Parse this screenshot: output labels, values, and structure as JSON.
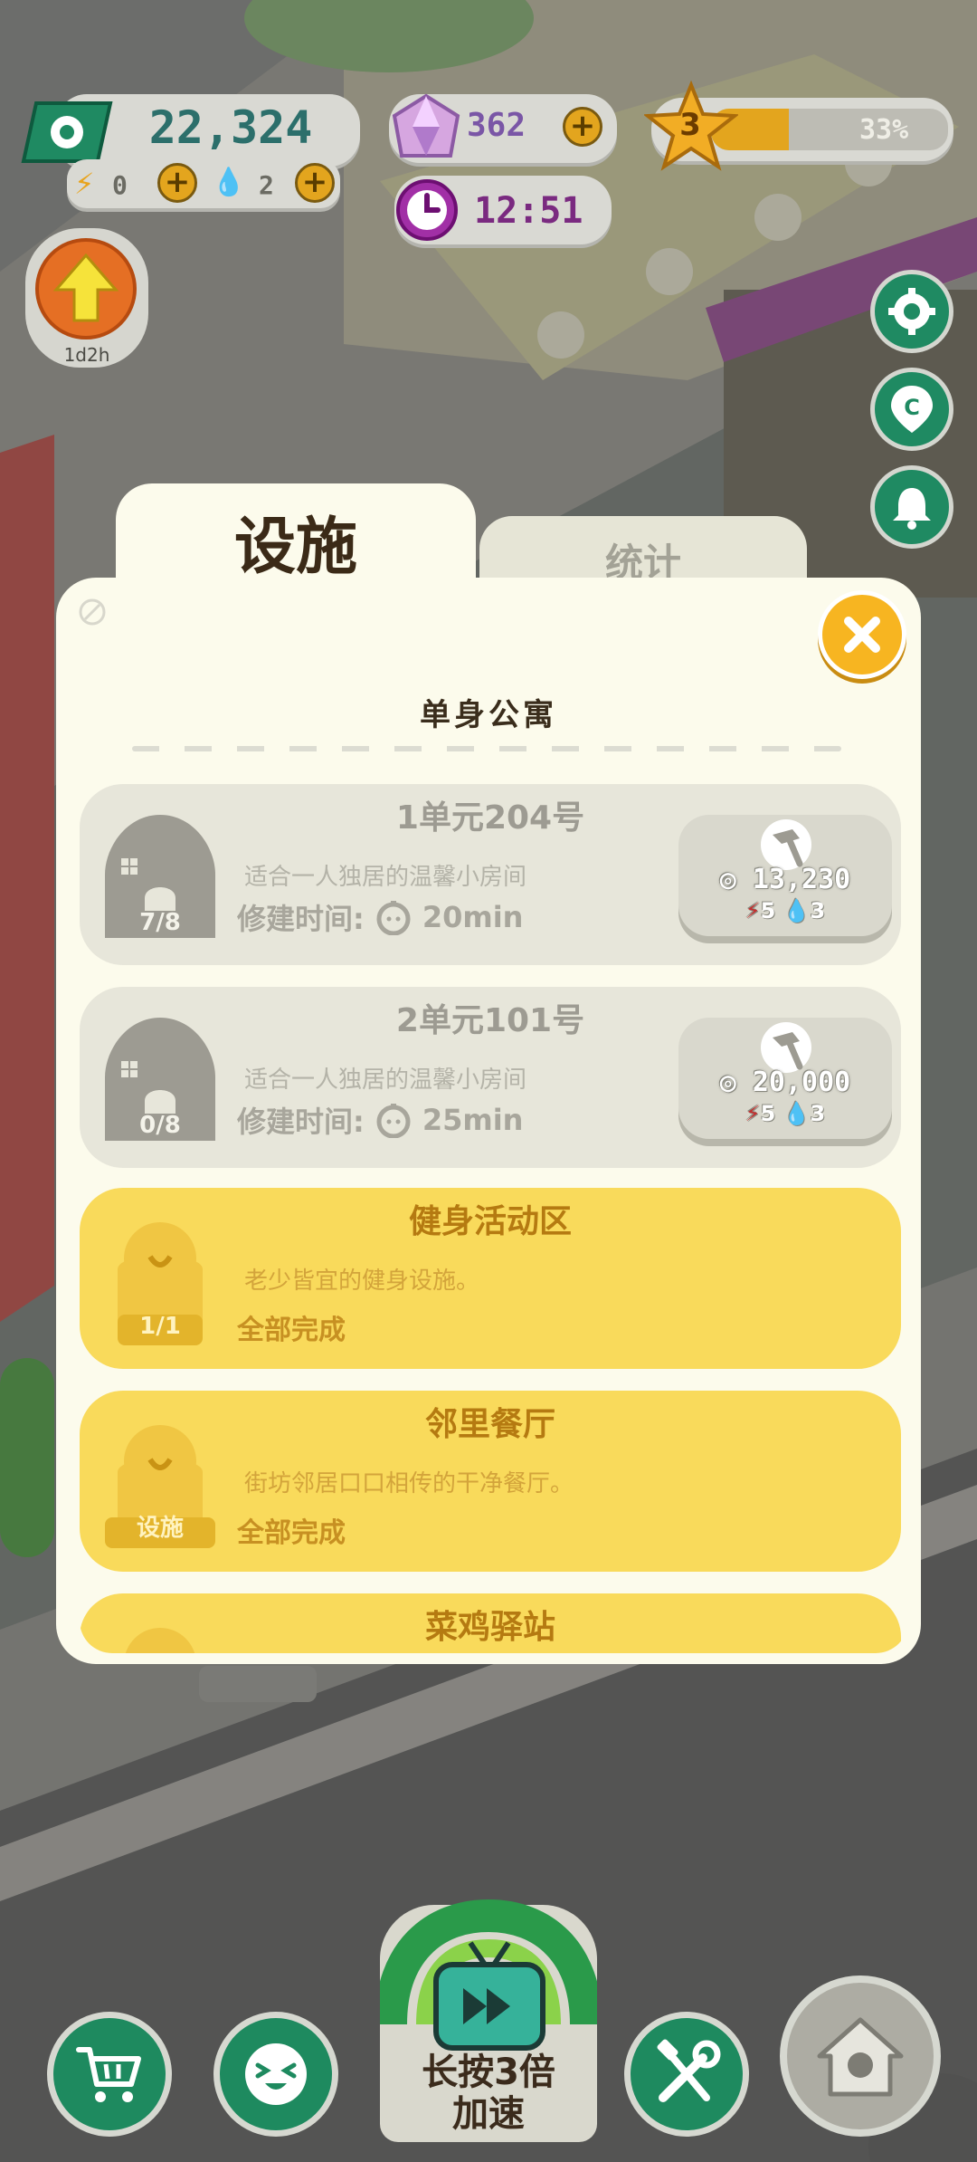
{
  "hud": {
    "cash": "22,324",
    "energy": "0",
    "water": "2",
    "gems": "362",
    "level": "3",
    "level_progress_text": "33%",
    "level_progress": 0.33,
    "clock": "12:51",
    "upgrade_timer": "1d2h"
  },
  "dialog": {
    "tabs": [
      "设施",
      "统计"
    ],
    "section_title": "单身公寓",
    "cards": [
      {
        "title": "1单元204号",
        "desc": "适合一人独居的温馨小房间",
        "build_label": "修建时间:",
        "build_time": "20min",
        "count": "7/8",
        "cost": "13,230",
        "req_energy": "5",
        "req_water": "3"
      },
      {
        "title": "2单元101号",
        "desc": "适合一人独居的温馨小房间",
        "build_label": "修建时间:",
        "build_time": "25min",
        "count": "0/8",
        "cost": "20,000",
        "req_energy": "5",
        "req_water": "3"
      },
      {
        "title": "健身活动区",
        "desc": "老少皆宜的健身设施。",
        "count": "1/1",
        "status": "全部完成"
      },
      {
        "title": "邻里餐厅",
        "desc": "街坊邻居口口相传的干净餐厅。",
        "count": "设施",
        "status": "全部完成"
      },
      {
        "title": "菜鸡驿站"
      }
    ]
  },
  "bottom": {
    "speed_label_line1": "长按3倍",
    "speed_label_line2": "加速"
  },
  "colors": {
    "panel": "#fcfbec",
    "done_card": "#f9da5b",
    "locked_card": "#e7e6da",
    "hud_green": "#1f8a62",
    "gold": "#f7b521"
  }
}
